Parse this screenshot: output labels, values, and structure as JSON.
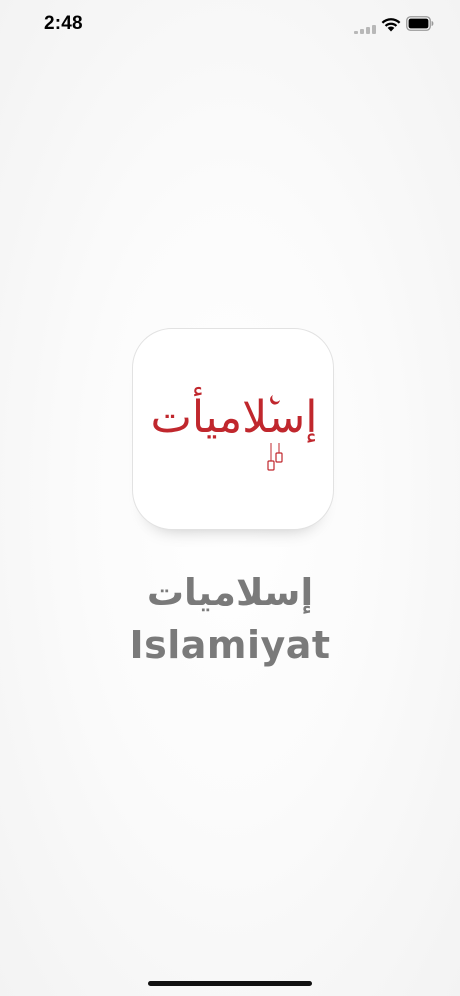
{
  "status_bar": {
    "time": "2:48",
    "signal_icon": "cellular-signal-icon",
    "wifi_icon": "wifi-icon",
    "battery_icon": "battery-icon"
  },
  "splash": {
    "logo_text": "إسلاميأت",
    "logo_color": "#c0272d",
    "app_name_ar": "إسلاميات",
    "app_name_en": "Islamiyat",
    "text_color": "#7a7a7a"
  }
}
